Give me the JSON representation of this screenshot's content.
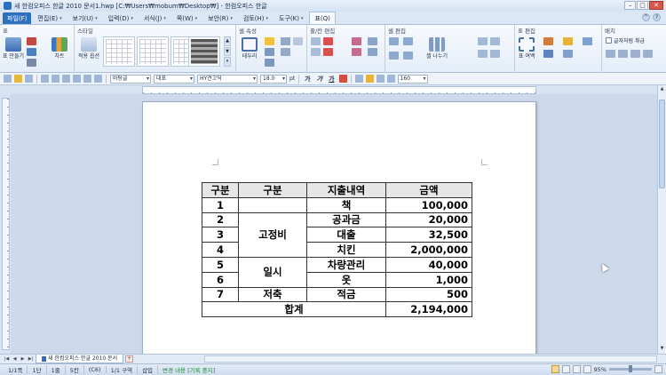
{
  "window": {
    "title": "새 한컴오피스 한글 2010 문서1.hwp [C:₩Users₩mobum₩Desktop₩] - 한컴오피스 한글"
  },
  "menu": [
    {
      "label": "파일(F)",
      "kind": "file"
    },
    {
      "label": "편집(E)"
    },
    {
      "label": "보기(U)"
    },
    {
      "label": "입력(D)"
    },
    {
      "label": "서식(J)"
    },
    {
      "label": "쪽(W)"
    },
    {
      "label": "보안(R)"
    },
    {
      "label": "검토(H)"
    },
    {
      "label": "도구(K)"
    },
    {
      "label": "표(Q)",
      "active": true
    }
  ],
  "ribbon": {
    "groups": [
      {
        "title": "표",
        "buttons": [
          "표 만들기",
          "차트"
        ]
      },
      {
        "title": "스타일",
        "buttons": [
          "적용 옵션"
        ]
      },
      {
        "title": "셀 속성",
        "buttons": [
          "테두리"
        ]
      },
      {
        "title": "줄/칸 편집",
        "buttons": []
      },
      {
        "title": "셀 편집",
        "buttons": [
          "셀 나누기"
        ]
      },
      {
        "title": "표 편집",
        "buttons": [
          "표 여백"
        ]
      },
      {
        "title": "배치",
        "buttons": [
          "글자처럼 취급"
        ]
      }
    ]
  },
  "toolbar": {
    "style_combo": "바탕글",
    "lang_combo": "대표",
    "font_combo": "HY견고딕",
    "size_combo": "18.0",
    "size_unit": "pt",
    "bold": "가",
    "italic": "가",
    "underline": "가",
    "zoom_combo": "160"
  },
  "table": {
    "headers": [
      "구분",
      "구분",
      "지출내역",
      "금액"
    ],
    "rows": [
      {
        "no": "1",
        "detail": "책",
        "amount": "100,000"
      },
      {
        "no": "2",
        "detail": "공과금",
        "amount": "20,000"
      },
      {
        "no": "3",
        "detail": "대출",
        "amount": "32,500"
      },
      {
        "no": "4",
        "detail": "치킨",
        "amount": "2,000,000"
      },
      {
        "no": "5",
        "detail": "차량관리",
        "amount": "40,000"
      },
      {
        "no": "6",
        "detail": "옷",
        "amount": "1,000"
      },
      {
        "no": "7",
        "detail": "적금",
        "amount": "500"
      }
    ],
    "groups": {
      "fixed": "고정비",
      "temp": "일시",
      "saving": "저축"
    },
    "total_label": "합계",
    "total_amount": "2,194,000"
  },
  "doc_tab": {
    "label": "새 한컴오피스 한글 2010 문서",
    "add": "+"
  },
  "status": {
    "page": "1/1쪽",
    "section": "1단",
    "line": "1줄",
    "col": "5칸",
    "mode": "(C6)",
    "area": "1/1 구역",
    "insert": "삽입",
    "track": "변경 내용 [기록 중지]",
    "zoom": "95%"
  },
  "colors": {
    "accent": "#2f6fc0",
    "header_fill": "#e6e6e6"
  }
}
